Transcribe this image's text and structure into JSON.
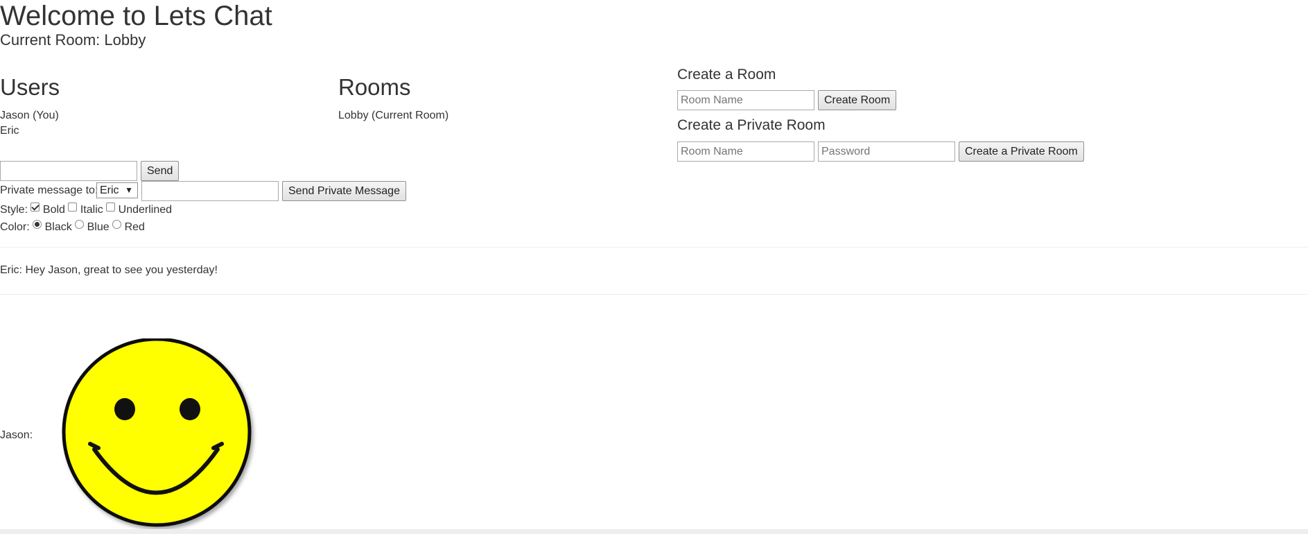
{
  "header": {
    "title": "Welcome to Lets Chat",
    "current_room_label": "Current Room: Lobby"
  },
  "users": {
    "heading": "Users",
    "items": [
      "Jason (You)",
      "Eric"
    ]
  },
  "rooms": {
    "heading": "Rooms",
    "items": [
      "Lobby (Current Room)"
    ]
  },
  "create_room": {
    "heading": "Create a Room",
    "name_placeholder": "Room Name",
    "button_label": "Create Room"
  },
  "create_private_room": {
    "heading": "Create a Private Room",
    "name_placeholder": "Room Name",
    "password_placeholder": "Password",
    "button_label": "Create a Private Room"
  },
  "compose": {
    "message_value": "",
    "send_label": "Send",
    "private_label": "Private message to:",
    "private_recipient": "Eric",
    "private_message_value": "",
    "send_private_label": "Send Private Message"
  },
  "style": {
    "label": "Style:",
    "options": [
      {
        "label": "Bold",
        "checked": true
      },
      {
        "label": "Italic",
        "checked": false
      },
      {
        "label": "Underlined",
        "checked": false
      }
    ]
  },
  "color": {
    "label": "Color:",
    "options": [
      {
        "label": "Black",
        "selected": true
      },
      {
        "label": "Blue",
        "selected": false
      },
      {
        "label": "Red",
        "selected": false
      }
    ]
  },
  "messages": [
    {
      "text": "Eric: Hey Jason, great to see you yesterday!"
    },
    {
      "sender": "Jason:",
      "image": "smiley-face-icon"
    }
  ],
  "colors": {
    "text": "#333333",
    "smiley_fill": "#ffff00",
    "divider": "#eeeeee"
  }
}
